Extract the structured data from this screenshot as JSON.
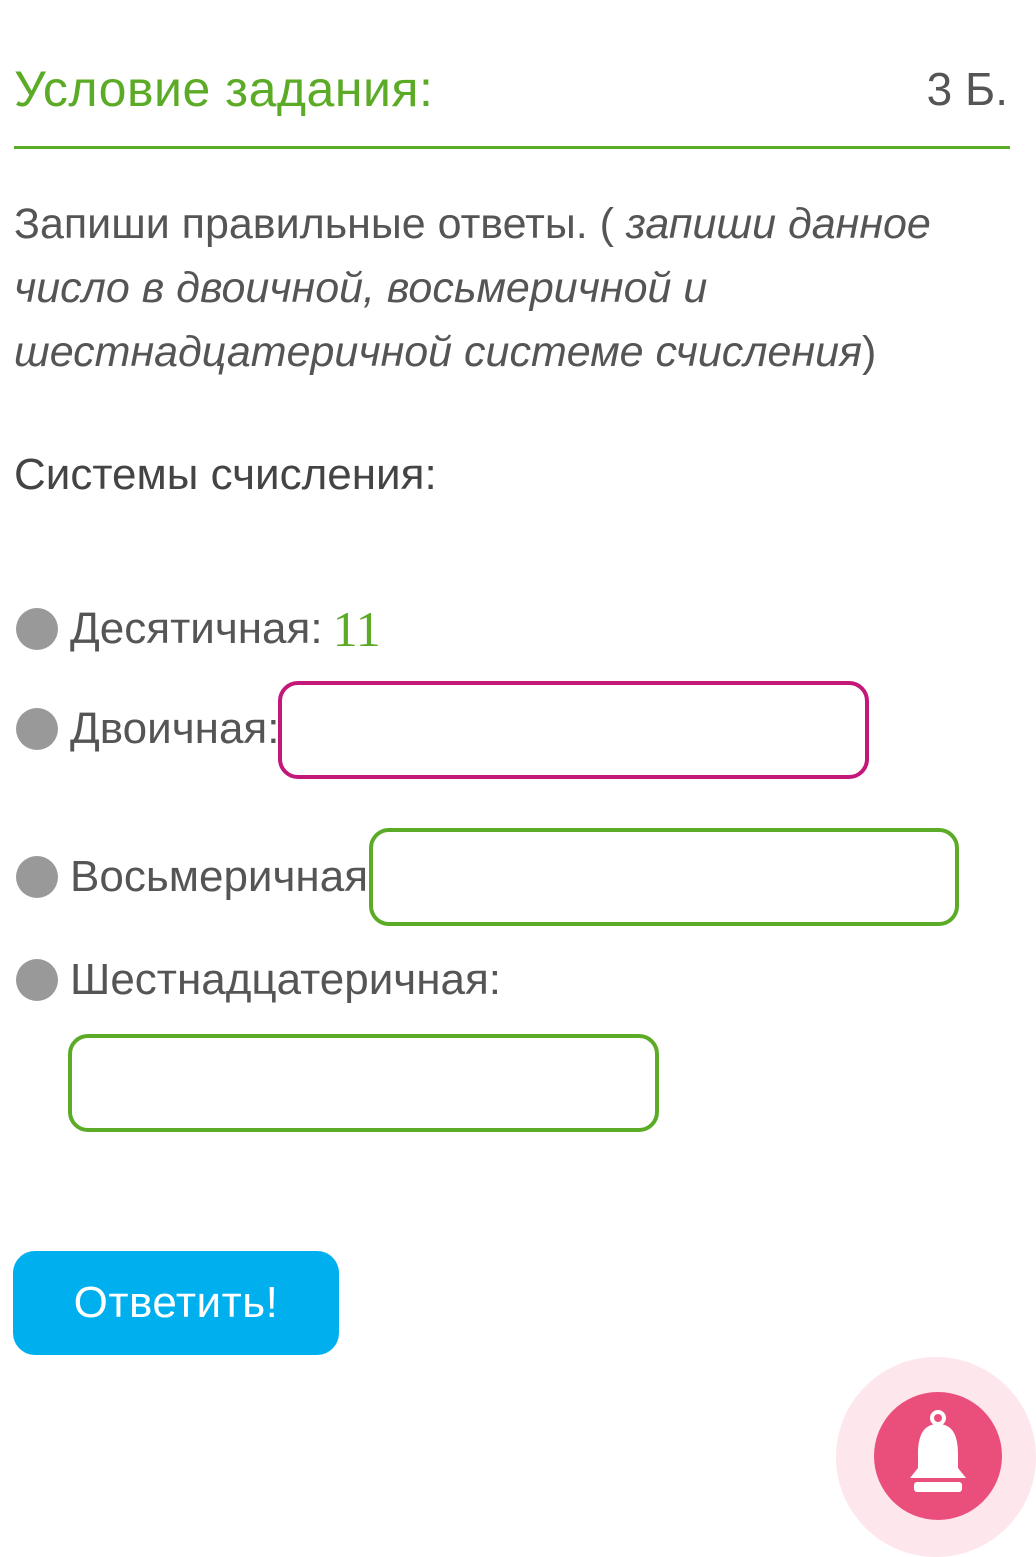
{
  "header": {
    "title": "Условие задания:",
    "points": "3 Б."
  },
  "instruction": {
    "text": "Запиши правильные ответы. ( ",
    "hint": "запиши данное число в двоичной, восьмеричной и шестнадцатеричной системе счисления",
    "close": ")"
  },
  "section_title": "Системы счисления:",
  "rows": [
    {
      "label": "Десятичная:",
      "value": "11"
    },
    {
      "label": "Двоичная:",
      "input_value": "",
      "state": "error"
    },
    {
      "label": "Восьмеричная:",
      "input_value": "",
      "state": "correct"
    },
    {
      "label": "Шестнадцатеричная:",
      "input_value": "",
      "state": "correct"
    }
  ],
  "submit_label": "Ответить!",
  "notification_icon": "bell-icon",
  "colors": {
    "accent_green": "#5cab26",
    "error_magenta": "#c4177a",
    "button_blue": "#00b0ee",
    "notify_pink": "#ea4f7c"
  }
}
